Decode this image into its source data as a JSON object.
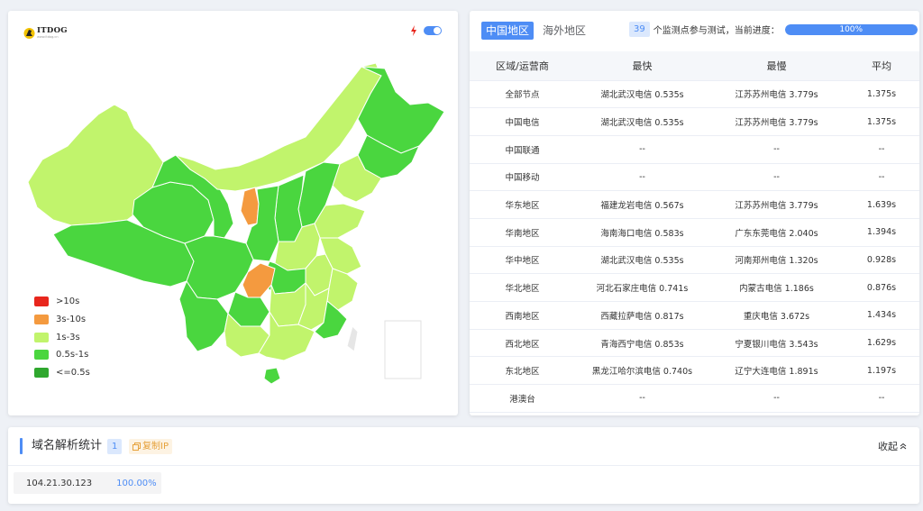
{
  "brand": {
    "name": "ITDOG",
    "url": "www.itdog.cn"
  },
  "colors": {
    "accent": "#4e8df5",
    "gt10s": "#e8261d",
    "s3_10": "#f49a3f",
    "s1_3": "#c1f46c",
    "s05_1": "#4ad63f",
    "lt05": "#2fa72e"
  },
  "toggle": {
    "on": true
  },
  "legend": [
    {
      "label": ">10s",
      "color": "#e8261d"
    },
    {
      "label": "3s-10s",
      "color": "#f49a3f"
    },
    {
      "label": "1s-3s",
      "color": "#c1f46c"
    },
    {
      "label": "0.5s-1s",
      "color": "#4ad63f"
    },
    {
      "label": "<=0.5s",
      "color": "#2fa72e"
    }
  ],
  "tabs": [
    {
      "label": "中国地区",
      "active": true
    },
    {
      "label": "海外地区",
      "active": false
    }
  ],
  "progress": {
    "count": "39",
    "text": "个监测点参与测试，当前进度：",
    "label": "100%",
    "value": 1.0
  },
  "table": {
    "headers": [
      "区域/运营商",
      "最快",
      "最慢",
      "平均"
    ],
    "rows": [
      [
        "全部节点",
        "湖北武汉电信 0.535s",
        "江苏苏州电信 3.779s",
        "1.375s"
      ],
      [
        "中国电信",
        "湖北武汉电信 0.535s",
        "江苏苏州电信 3.779s",
        "1.375s"
      ],
      [
        "中国联通",
        "--",
        "--",
        "--"
      ],
      [
        "中国移动",
        "--",
        "--",
        "--"
      ],
      [
        "华东地区",
        "福建龙岩电信 0.567s",
        "江苏苏州电信 3.779s",
        "1.639s"
      ],
      [
        "华南地区",
        "海南海口电信 0.583s",
        "广东东莞电信 2.040s",
        "1.394s"
      ],
      [
        "华中地区",
        "湖北武汉电信 0.535s",
        "河南郑州电信 1.320s",
        "0.928s"
      ],
      [
        "华北地区",
        "河北石家庄电信 0.741s",
        "内蒙古电信 1.186s",
        "0.876s"
      ],
      [
        "西南地区",
        "西藏拉萨电信 0.817s",
        "重庆电信 3.672s",
        "1.434s"
      ],
      [
        "西北地区",
        "青海西宁电信 0.853s",
        "宁夏银川电信 3.543s",
        "1.629s"
      ],
      [
        "东北地区",
        "黑龙江哈尔滨电信 0.740s",
        "辽宁大连电信 1.891s",
        "1.197s"
      ],
      [
        "港澳台",
        "--",
        "--",
        "--"
      ]
    ]
  },
  "dns": {
    "title": "域名解析统计",
    "count": "1",
    "copy_label": "复制IP",
    "collapse_label": "收起",
    "rows": [
      {
        "ip": "104.21.30.123",
        "percent": "100.00%"
      }
    ]
  }
}
